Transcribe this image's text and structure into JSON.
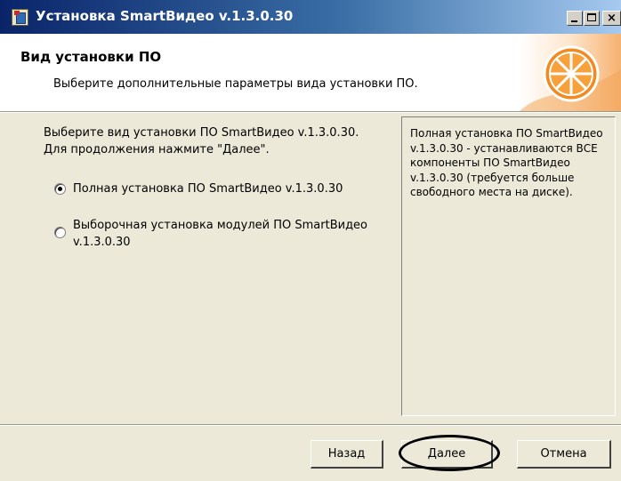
{
  "window": {
    "title": "Установка SmartВидео v.1.3.0.30",
    "icon": "installer-icon",
    "controls": {
      "minimize": "minimize-icon",
      "maximize": "maximize-icon",
      "close_glyph": "×"
    }
  },
  "banner": {
    "title": "Вид установки ПО",
    "subtitle": "Выберите дополнительные параметры вида установки ПО.",
    "logo": "orange-slice-logo",
    "accent_color": "#f28a1f"
  },
  "main": {
    "instruction_line1": "Выберите вид установки ПО SmartВидео v.1.3.0.30.",
    "instruction_line2": "Для продолжения нажмите \"Далее\".",
    "options": [
      {
        "label": "Полная установка ПО SmartВидео v.1.3.0.30",
        "checked": true
      },
      {
        "label_line1": "Выборочная установка модулей ПО SmartВидео",
        "label_line2": "v.1.3.0.30",
        "checked": false
      }
    ],
    "description": "Полная установка ПО SmartВидео v.1.3.0.30 - устанавливаются ВСЕ компоненты ПО SmartВидео v.1.3.0.30 (требуется больше свободного места на диске)."
  },
  "buttons": {
    "back": "Назад",
    "next": "Далее",
    "cancel": "Отмена"
  },
  "colors": {
    "titlebar_start": "#0a246a",
    "titlebar_end": "#a6caf0",
    "dialog_bg": "#ece9d8"
  }
}
